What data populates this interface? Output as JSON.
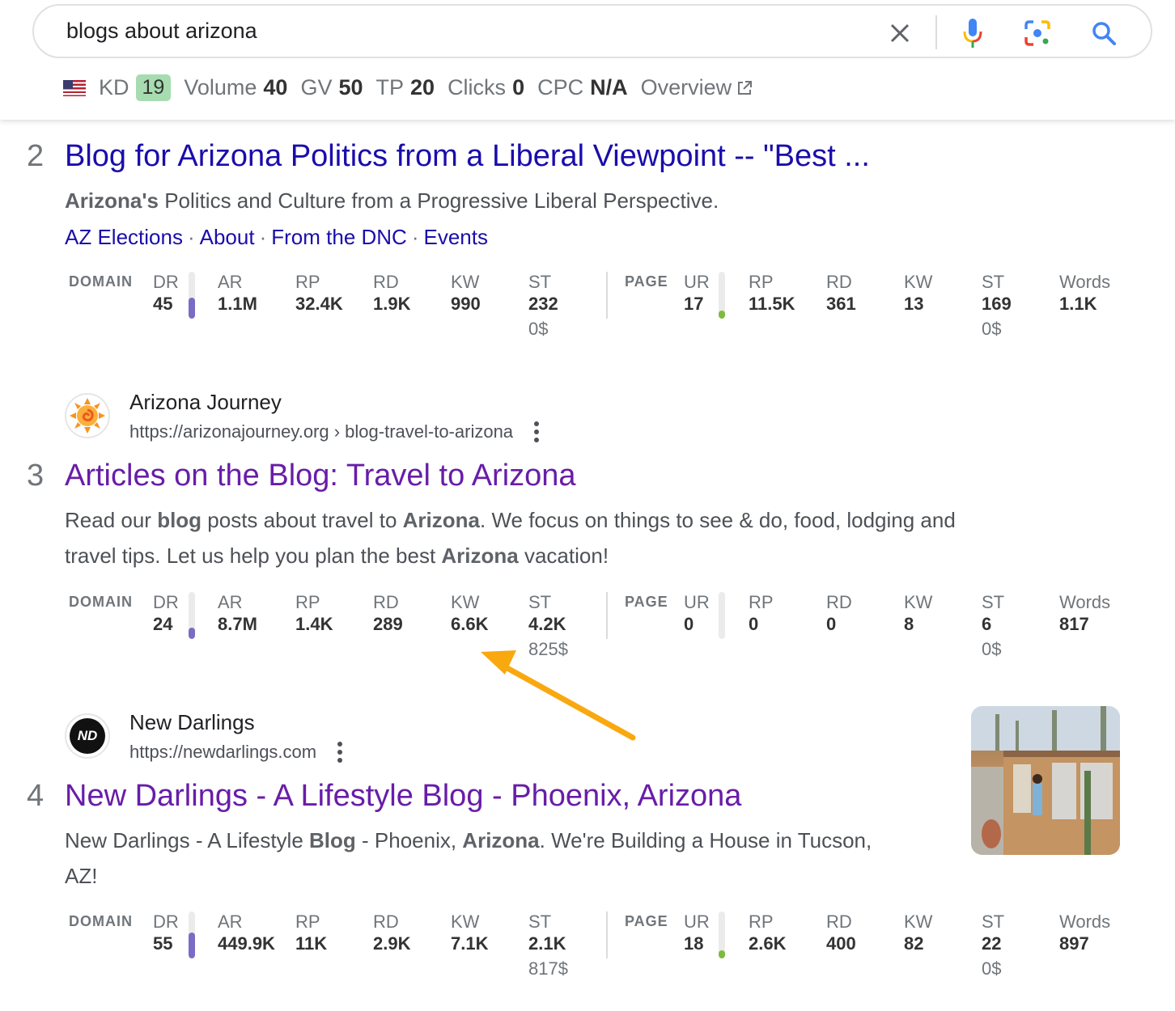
{
  "search": {
    "query": "blogs about arizona",
    "icons": [
      "close-icon",
      "microphone-icon",
      "google-lens-icon",
      "search-icon"
    ]
  },
  "keyword_bar": {
    "country_icon": "us-flag-icon",
    "kd_label": "KD",
    "kd_value": "19",
    "kd_color": "#a6dcb0",
    "volume_label": "Volume",
    "volume_value": "40",
    "gv_label": "GV",
    "gv_value": "50",
    "tp_label": "TP",
    "tp_value": "20",
    "clicks_label": "Clicks",
    "clicks_value": "0",
    "cpc_label": "CPC",
    "cpc_value": "N/A",
    "overview_label": "Overview"
  },
  "metric_labels": {
    "domain": "DOMAIN",
    "page": "PAGE",
    "dr": "DR",
    "ar": "AR",
    "rp": "RP",
    "rd": "RD",
    "kw": "KW",
    "st": "ST",
    "ur": "UR",
    "words": "Words"
  },
  "colors": {
    "dr_bar": "#7b6bc4",
    "ur_bar": "#7cbc3c",
    "link_blue": "#1a0dab",
    "link_visited": "#681da8",
    "arrow": "#f9a80f"
  },
  "results": [
    {
      "rank": "2",
      "title": "Blog for Arizona Politics from a Liberal Viewpoint -- \"Best ...",
      "snippet_bold": "Arizona's",
      "snippet_rest": " Politics and Culture from a Progressive Liberal Perspective.",
      "sitelinks": [
        "AZ Elections",
        "About",
        "From the DNC",
        "Events"
      ],
      "domain": {
        "dr": "45",
        "dr_fraction": 0.45,
        "ar": "1.1M",
        "rp": "32.4K",
        "rd": "1.9K",
        "kw": "990",
        "st": "232",
        "st_value": "0$"
      },
      "page": {
        "ur": "17",
        "ur_fraction": 0.17,
        "rp": "11.5K",
        "rd": "361",
        "kw": "13",
        "st": "169",
        "st_value": "0$",
        "words": "1.1K"
      }
    },
    {
      "rank": "3",
      "site_name": "Arizona Journey",
      "site_url": "https://arizonajourney.org › blog-travel-to-arizona",
      "title": "Articles on the Blog: Travel to Arizona",
      "snippet_line1": [
        "Read our ",
        "blog",
        " posts about travel to ",
        "Arizona",
        ". We focus on things to see & do, food, lodging and"
      ],
      "snippet_line2": [
        "travel tips. Let us help you plan the best ",
        "Arizona",
        " vacation!"
      ],
      "domain": {
        "dr": "24",
        "dr_fraction": 0.24,
        "ar": "8.7M",
        "rp": "1.4K",
        "rd": "289",
        "kw": "6.6K",
        "st": "4.2K",
        "st_value": "825$"
      },
      "page": {
        "ur": "0",
        "ur_fraction": 0,
        "rp": "0",
        "rd": "0",
        "kw": "8",
        "st": "6",
        "st_value": "0$",
        "words": "817"
      }
    },
    {
      "rank": "4",
      "site_name": "New Darlings",
      "site_url": "https://newdarlings.com",
      "favicon_text": "ND",
      "title": "New Darlings - A Lifestyle Blog - Phoenix, Arizona",
      "snippet_line1": [
        "New Darlings - A Lifestyle ",
        "Blog",
        " - Phoenix, ",
        "Arizona",
        ". We're Building a House in Tucson,"
      ],
      "snippet_line2": [
        "AZ!"
      ],
      "domain": {
        "dr": "55",
        "dr_fraction": 0.55,
        "ar": "449.9K",
        "rp": "11K",
        "rd": "2.9K",
        "kw": "7.1K",
        "st": "2.1K",
        "st_value": "817$"
      },
      "page": {
        "ur": "18",
        "ur_fraction": 0.18,
        "rp": "2.6K",
        "rd": "400",
        "kw": "82",
        "st": "22",
        "st_value": "0$",
        "words": "897"
      }
    }
  ]
}
